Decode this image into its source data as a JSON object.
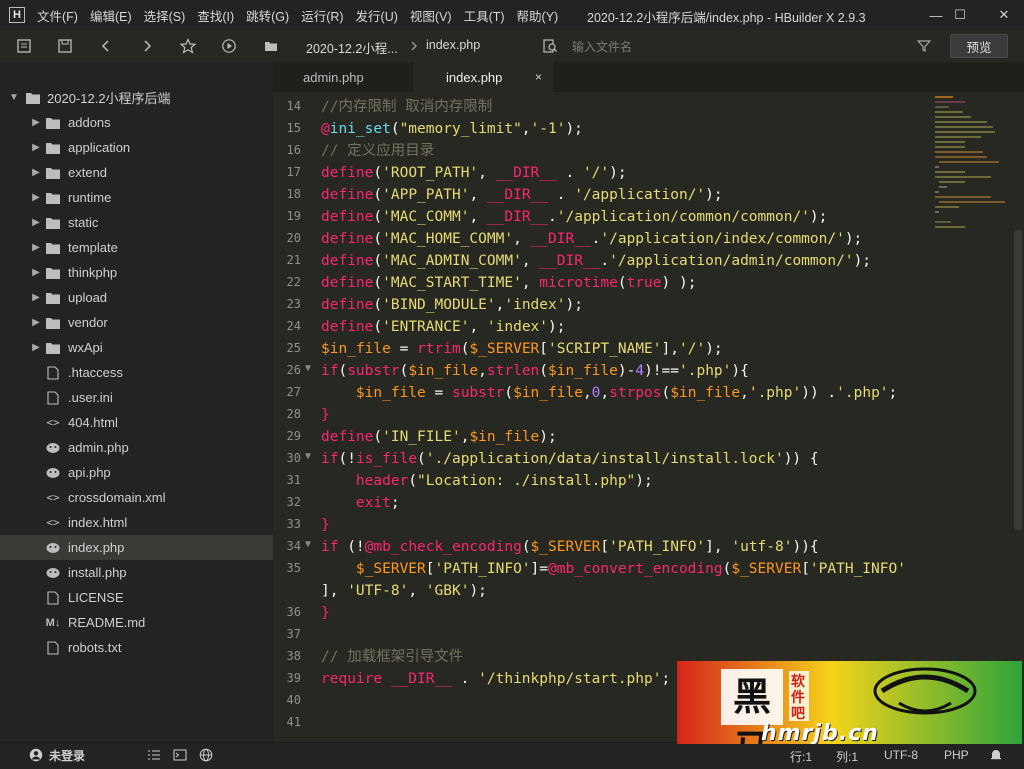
{
  "window": {
    "app_logo": "H",
    "title": "2020-12.2小程序后端/index.php - HBuilder X 2.9.3",
    "menu": [
      "文件(F)",
      "编辑(E)",
      "选择(S)",
      "查找(I)",
      "跳转(G)",
      "运行(R)",
      "发行(U)",
      "视图(V)",
      "工具(T)",
      "帮助(Y)"
    ],
    "controls": {
      "minimize": "—",
      "maximize": "☐",
      "close": "✕"
    }
  },
  "toolbar": {
    "breadcrumb_project": "2020-12.2小程...",
    "breadcrumb_file": "index.php",
    "search_placeholder": "输入文件名",
    "preview_label": "预览"
  },
  "sidebar": {
    "project": "2020-12.2小程序后端",
    "items": [
      {
        "label": "addons",
        "type": "folder"
      },
      {
        "label": "application",
        "type": "folder"
      },
      {
        "label": "extend",
        "type": "folder"
      },
      {
        "label": "runtime",
        "type": "folder"
      },
      {
        "label": "static",
        "type": "folder"
      },
      {
        "label": "template",
        "type": "folder"
      },
      {
        "label": "thinkphp",
        "type": "folder"
      },
      {
        "label": "upload",
        "type": "folder"
      },
      {
        "label": "vendor",
        "type": "folder"
      },
      {
        "label": "wxApi",
        "type": "folder"
      },
      {
        "label": ".htaccess",
        "type": "file"
      },
      {
        "label": ".user.ini",
        "type": "file"
      },
      {
        "label": "404.html",
        "type": "html"
      },
      {
        "label": "admin.php",
        "type": "php"
      },
      {
        "label": "api.php",
        "type": "php"
      },
      {
        "label": "crossdomain.xml",
        "type": "html"
      },
      {
        "label": "index.html",
        "type": "html"
      },
      {
        "label": "index.php",
        "type": "php",
        "selected": true
      },
      {
        "label": "install.php",
        "type": "php"
      },
      {
        "label": "LICENSE",
        "type": "file"
      },
      {
        "label": "README.md",
        "type": "md"
      },
      {
        "label": "robots.txt",
        "type": "file"
      }
    ]
  },
  "tabs": [
    {
      "label": "admin.php",
      "active": false
    },
    {
      "label": "index.php",
      "active": true
    }
  ],
  "tab_close_glyph": "×",
  "editor": {
    "lines": [
      {
        "n": "14",
        "segs": [
          [
            "c-comment",
            "//内存限制 取消内存限制"
          ]
        ]
      },
      {
        "n": "15",
        "segs": [
          [
            "c-kw",
            "@"
          ],
          [
            "c-fn",
            "ini_set"
          ],
          [
            "c-plain",
            "("
          ],
          [
            "c-str",
            "\"memory_limit\""
          ],
          [
            "c-plain",
            ","
          ],
          [
            "c-str",
            "'-1'"
          ],
          [
            "c-plain",
            ");"
          ]
        ]
      },
      {
        "n": "16",
        "segs": [
          [
            "c-comment",
            "// 定义应用目录"
          ]
        ]
      },
      {
        "n": "17",
        "segs": [
          [
            "c-kw",
            "define"
          ],
          [
            "c-plain",
            "("
          ],
          [
            "c-str",
            "'ROOT_PATH'"
          ],
          [
            "c-plain",
            ", "
          ],
          [
            "c-kw",
            "__DIR__"
          ],
          [
            "c-plain",
            " . "
          ],
          [
            "c-str",
            "'/'"
          ],
          [
            "c-plain",
            ");"
          ]
        ]
      },
      {
        "n": "18",
        "segs": [
          [
            "c-kw",
            "define"
          ],
          [
            "c-plain",
            "("
          ],
          [
            "c-str",
            "'APP_PATH'"
          ],
          [
            "c-plain",
            ", "
          ],
          [
            "c-kw",
            "__DIR__"
          ],
          [
            "c-plain",
            " . "
          ],
          [
            "c-str",
            "'/application/'"
          ],
          [
            "c-plain",
            ");"
          ]
        ]
      },
      {
        "n": "19",
        "segs": [
          [
            "c-kw",
            "define"
          ],
          [
            "c-plain",
            "("
          ],
          [
            "c-str",
            "'MAC_COMM'"
          ],
          [
            "c-plain",
            ", "
          ],
          [
            "c-kw",
            "__DIR__"
          ],
          [
            "c-plain",
            "."
          ],
          [
            "c-str",
            "'/application/common/common/'"
          ],
          [
            "c-plain",
            ");"
          ]
        ]
      },
      {
        "n": "20",
        "segs": [
          [
            "c-kw",
            "define"
          ],
          [
            "c-plain",
            "("
          ],
          [
            "c-str",
            "'MAC_HOME_COMM'"
          ],
          [
            "c-plain",
            ", "
          ],
          [
            "c-kw",
            "__DIR__"
          ],
          [
            "c-plain",
            "."
          ],
          [
            "c-str",
            "'/application/index/common/'"
          ],
          [
            "c-plain",
            ");"
          ]
        ]
      },
      {
        "n": "21",
        "segs": [
          [
            "c-kw",
            "define"
          ],
          [
            "c-plain",
            "("
          ],
          [
            "c-str",
            "'MAC_ADMIN_COMM'"
          ],
          [
            "c-plain",
            ", "
          ],
          [
            "c-kw",
            "__DIR__"
          ],
          [
            "c-plain",
            "."
          ],
          [
            "c-str",
            "'/application/admin/common/'"
          ],
          [
            "c-plain",
            ");"
          ]
        ]
      },
      {
        "n": "22",
        "segs": [
          [
            "c-kw",
            "define"
          ],
          [
            "c-plain",
            "("
          ],
          [
            "c-str",
            "'MAC_START_TIME'"
          ],
          [
            "c-plain",
            ", "
          ],
          [
            "c-kw",
            "microtime"
          ],
          [
            "c-plain",
            "("
          ],
          [
            "c-kw",
            "true"
          ],
          [
            "c-plain",
            ") );"
          ]
        ]
      },
      {
        "n": "23",
        "segs": [
          [
            "c-kw",
            "define"
          ],
          [
            "c-plain",
            "("
          ],
          [
            "c-str",
            "'BIND_MODULE'"
          ],
          [
            "c-plain",
            ","
          ],
          [
            "c-str",
            "'index'"
          ],
          [
            "c-plain",
            ");"
          ]
        ]
      },
      {
        "n": "24",
        "segs": [
          [
            "c-kw",
            "define"
          ],
          [
            "c-plain",
            "("
          ],
          [
            "c-str",
            "'ENTRANCE'"
          ],
          [
            "c-plain",
            ", "
          ],
          [
            "c-str",
            "'index'"
          ],
          [
            "c-plain",
            ");"
          ]
        ]
      },
      {
        "n": "25",
        "segs": [
          [
            "c-var",
            "$in_file"
          ],
          [
            "c-plain",
            " = "
          ],
          [
            "c-kw",
            "rtrim"
          ],
          [
            "c-plain",
            "("
          ],
          [
            "c-var",
            "$_SERVER"
          ],
          [
            "c-plain",
            "["
          ],
          [
            "c-str",
            "'SCRIPT_NAME'"
          ],
          [
            "c-plain",
            "],"
          ],
          [
            "c-str",
            "'/'"
          ],
          [
            "c-plain",
            ");"
          ]
        ]
      },
      {
        "n": "26",
        "fold": true,
        "segs": [
          [
            "c-kw",
            "if"
          ],
          [
            "c-plain",
            "("
          ],
          [
            "c-kw",
            "substr"
          ],
          [
            "c-plain",
            "("
          ],
          [
            "c-var",
            "$in_file"
          ],
          [
            "c-plain",
            ","
          ],
          [
            "c-kw",
            "strlen"
          ],
          [
            "c-plain",
            "("
          ],
          [
            "c-var",
            "$in_file"
          ],
          [
            "c-plain",
            ")-"
          ],
          [
            "c-num",
            "4"
          ],
          [
            "c-plain",
            ")!=="
          ],
          [
            "c-str",
            "'.php'"
          ],
          [
            "c-plain",
            "){"
          ]
        ]
      },
      {
        "n": "27",
        "segs": [
          [
            "c-plain",
            "    "
          ],
          [
            "c-var",
            "$in_file"
          ],
          [
            "c-plain",
            " = "
          ],
          [
            "c-kw",
            "substr"
          ],
          [
            "c-plain",
            "("
          ],
          [
            "c-var",
            "$in_file"
          ],
          [
            "c-plain",
            ","
          ],
          [
            "c-num",
            "0"
          ],
          [
            "c-plain",
            ","
          ],
          [
            "c-kw",
            "strpos"
          ],
          [
            "c-plain",
            "("
          ],
          [
            "c-var",
            "$in_file"
          ],
          [
            "c-plain",
            ","
          ],
          [
            "c-str",
            "'.php'"
          ],
          [
            "c-plain",
            ")) ."
          ],
          [
            "c-str",
            "'.php'"
          ],
          [
            "c-plain",
            ";"
          ]
        ]
      },
      {
        "n": "28",
        "segs": [
          [
            "c-kw",
            "}"
          ]
        ]
      },
      {
        "n": "29",
        "segs": [
          [
            "c-kw",
            "define"
          ],
          [
            "c-plain",
            "("
          ],
          [
            "c-str",
            "'IN_FILE'"
          ],
          [
            "c-plain",
            ","
          ],
          [
            "c-var",
            "$in_file"
          ],
          [
            "c-plain",
            ");"
          ]
        ]
      },
      {
        "n": "30",
        "fold": true,
        "segs": [
          [
            "c-kw",
            "if"
          ],
          [
            "c-plain",
            "(!"
          ],
          [
            "c-kw",
            "is_file"
          ],
          [
            "c-plain",
            "("
          ],
          [
            "c-str",
            "'./application/data/install/install.lock'"
          ],
          [
            "c-plain",
            ")) {"
          ]
        ]
      },
      {
        "n": "31",
        "segs": [
          [
            "c-plain",
            "    "
          ],
          [
            "c-kw",
            "header"
          ],
          [
            "c-plain",
            "("
          ],
          [
            "c-str",
            "\"Location: ./install.php\""
          ],
          [
            "c-plain",
            ");"
          ]
        ]
      },
      {
        "n": "32",
        "segs": [
          [
            "c-plain",
            "    "
          ],
          [
            "c-kw",
            "exit"
          ],
          [
            "c-plain",
            ";"
          ]
        ]
      },
      {
        "n": "33",
        "segs": [
          [
            "c-kw",
            "}"
          ]
        ]
      },
      {
        "n": "34",
        "fold": true,
        "segs": [
          [
            "c-kw",
            "if"
          ],
          [
            "c-plain",
            " (!"
          ],
          [
            "c-kw",
            "@mb_check_encoding"
          ],
          [
            "c-plain",
            "("
          ],
          [
            "c-var",
            "$_SERVER"
          ],
          [
            "c-plain",
            "["
          ],
          [
            "c-str",
            "'PATH_INFO'"
          ],
          [
            "c-plain",
            "], "
          ],
          [
            "c-str",
            "'utf-8'"
          ],
          [
            "c-plain",
            ")){"
          ]
        ]
      },
      {
        "n": "35",
        "segs": [
          [
            "c-plain",
            "    "
          ],
          [
            "c-var",
            "$_SERVER"
          ],
          [
            "c-plain",
            "["
          ],
          [
            "c-str",
            "'PATH_INFO'"
          ],
          [
            "c-plain",
            "]="
          ],
          [
            "c-kw",
            "@mb_convert_encoding"
          ],
          [
            "c-plain",
            "("
          ],
          [
            "c-var",
            "$_SERVER"
          ],
          [
            "c-plain",
            "["
          ],
          [
            "c-str",
            "'PATH_INFO'"
          ]
        ]
      },
      {
        "n": "",
        "segs": [
          [
            "c-plain",
            "], "
          ],
          [
            "c-str",
            "'UTF-8'"
          ],
          [
            "c-plain",
            ", "
          ],
          [
            "c-str",
            "'GBK'"
          ],
          [
            "c-plain",
            ");"
          ]
        ]
      },
      {
        "n": "36",
        "segs": [
          [
            "c-kw",
            "}"
          ]
        ]
      },
      {
        "n": "37",
        "segs": []
      },
      {
        "n": "38",
        "segs": [
          [
            "c-comment",
            "// 加载框架引导文件"
          ]
        ]
      },
      {
        "n": "39",
        "segs": [
          [
            "c-kw",
            "require"
          ],
          [
            "c-plain",
            " "
          ],
          [
            "c-kw",
            "__DIR__"
          ],
          [
            "c-plain",
            " . "
          ],
          [
            "c-str",
            "'/thinkphp/start.php'"
          ],
          [
            "c-plain",
            ";"
          ]
        ]
      },
      {
        "n": "40",
        "segs": []
      },
      {
        "n": "41",
        "segs": []
      }
    ]
  },
  "statusbar": {
    "login": "未登录",
    "position": "行:1",
    "column": "列:1",
    "encoding": "UTF-8",
    "language": "PHP"
  },
  "watermark": {
    "logo_text": "黑马",
    "side_text": "软件吧",
    "site": "hmrjb.cn"
  }
}
